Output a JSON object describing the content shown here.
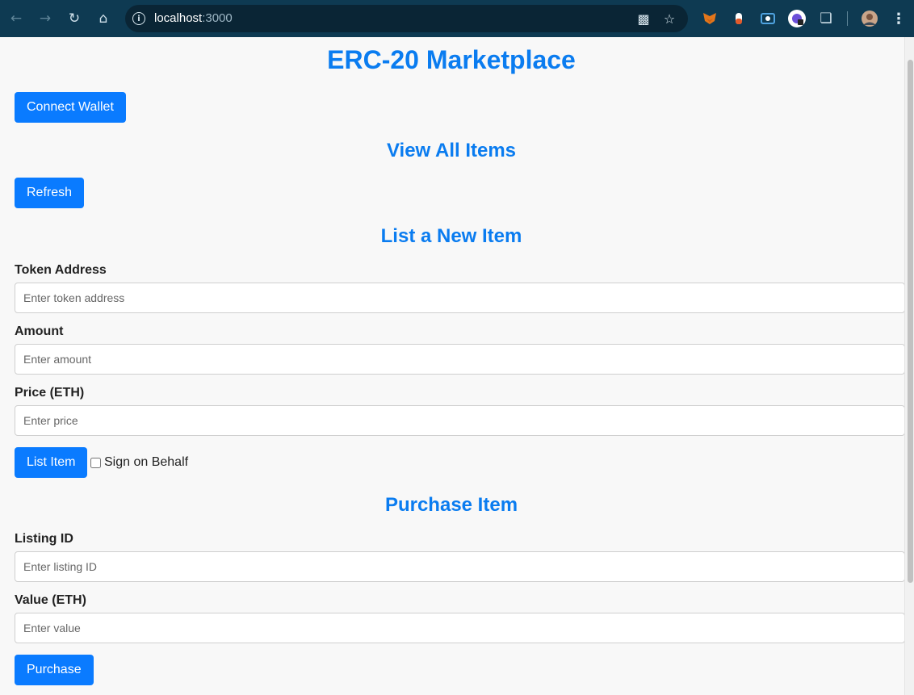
{
  "browser": {
    "url_host": "localhost",
    "url_port": ":3000",
    "nav": {
      "back_icon": "arrow-left-icon",
      "forward_icon": "arrow-right-icon",
      "reload_icon": "reload-icon",
      "home_icon": "home-icon"
    }
  },
  "page": {
    "title": "ERC-20 Marketplace",
    "connect_wallet_label": "Connect Wallet",
    "view_section": {
      "heading": "View All Items",
      "refresh_label": "Refresh"
    },
    "list_section": {
      "heading": "List a New Item",
      "fields": [
        {
          "label": "Token Address",
          "placeholder": "Enter token address",
          "value": ""
        },
        {
          "label": "Amount",
          "placeholder": "Enter amount",
          "value": ""
        },
        {
          "label": "Price (ETH)",
          "placeholder": "Enter price",
          "value": ""
        }
      ],
      "submit_label": "List Item",
      "sign_on_behalf_label": "Sign on Behalf",
      "sign_on_behalf_checked": false
    },
    "purchase_section": {
      "heading": "Purchase Item",
      "fields": [
        {
          "label": "Listing ID",
          "placeholder": "Enter listing ID",
          "value": ""
        },
        {
          "label": "Value (ETH)",
          "placeholder": "Enter value",
          "value": ""
        }
      ],
      "submit_label": "Purchase"
    }
  },
  "colors": {
    "accent": "#0a7bff",
    "heading": "#0a7cf0",
    "chrome": "#0e3a52"
  }
}
